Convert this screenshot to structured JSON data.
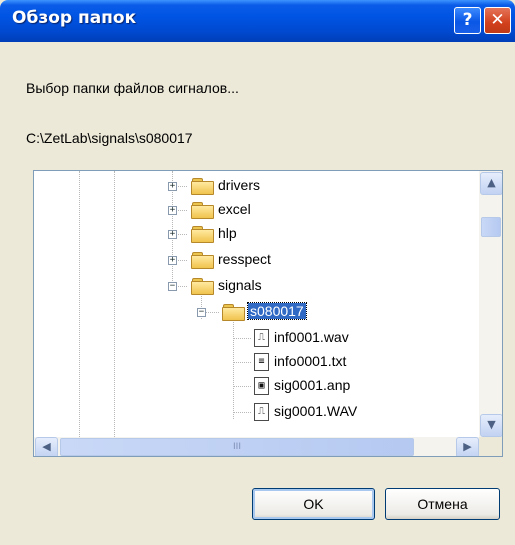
{
  "window": {
    "title": "Обзор папок"
  },
  "title_buttons": {
    "help": "?",
    "close": "✕"
  },
  "description": "Выбор папки файлов сигналов...",
  "current_path": "C:\\ZetLab\\signals\\s080017",
  "tree": {
    "folders": [
      {
        "label": "drivers",
        "expander": "+"
      },
      {
        "label": "excel",
        "expander": "+"
      },
      {
        "label": "hlp",
        "expander": "+"
      },
      {
        "label": "resspect",
        "expander": "+"
      },
      {
        "label": "signals",
        "expander": "−"
      }
    ],
    "selected_folder": {
      "label": "s080017",
      "expander": "−"
    },
    "files": [
      {
        "label": "inf0001.wav",
        "icon": "wav-file-icon",
        "glyph": "⎍"
      },
      {
        "label": "info0001.txt",
        "icon": "text-file-icon",
        "glyph": "≡"
      },
      {
        "label": "sig0001.anp",
        "icon": "anp-file-icon",
        "glyph": "▣"
      },
      {
        "label": "sig0001.WAV",
        "icon": "wav-file-icon",
        "glyph": "⎍"
      }
    ]
  },
  "scrollbars": {
    "up": "▲",
    "down": "▼",
    "left": "◀",
    "right": "▶",
    "grip": "III"
  },
  "buttons": {
    "ok": "OK",
    "cancel": "Отмена"
  },
  "colors": {
    "titlebar": "#0054E3",
    "selection": "#316AC5",
    "dialog": "#ECE9D8",
    "close": "#D2401C"
  }
}
